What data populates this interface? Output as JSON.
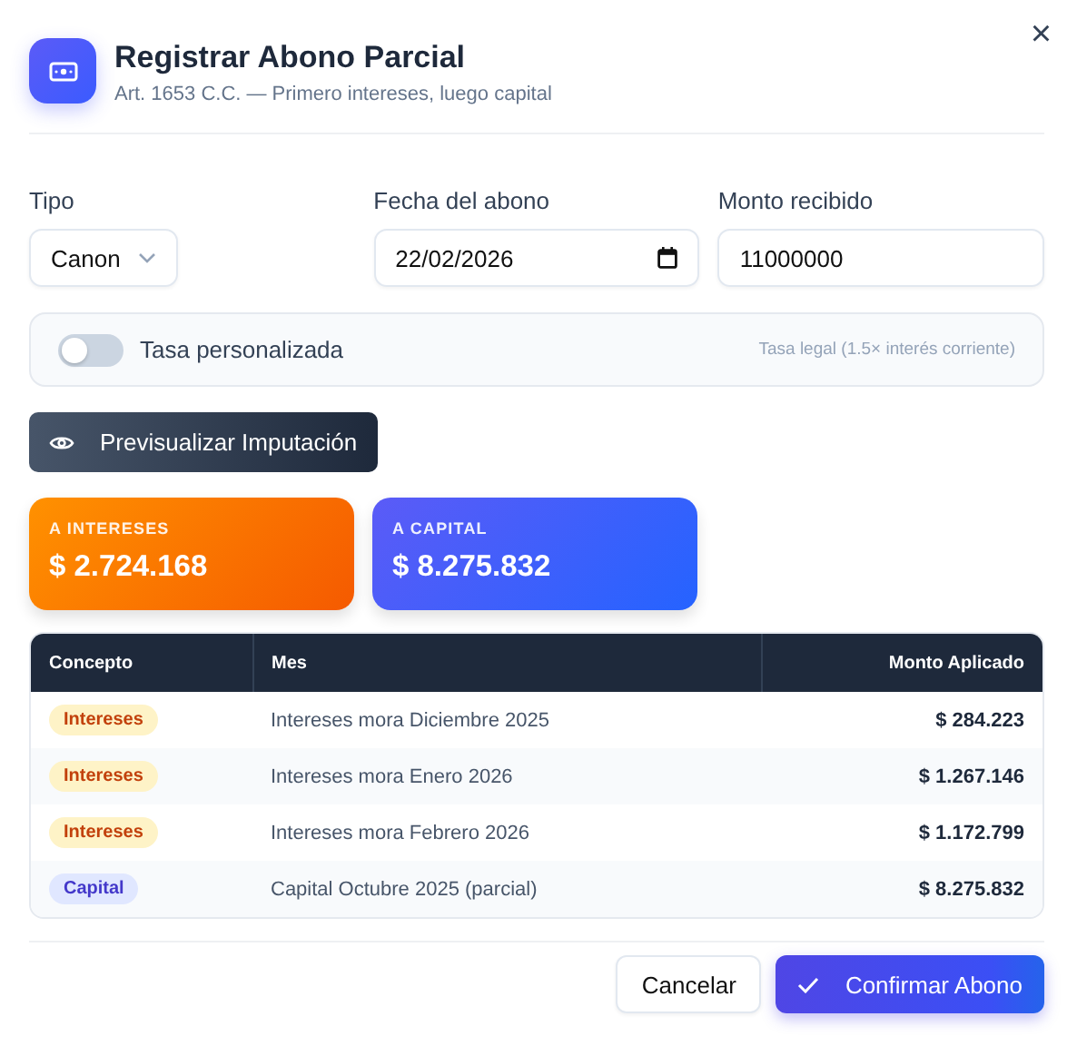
{
  "dialog": {
    "title": "Registrar Abono Parcial",
    "subtitle": "Art. 1653 C.C. — Primero intereses, luego capital",
    "close": "×"
  },
  "fields": {
    "tipo": {
      "label": "Tipo",
      "value": "Canon"
    },
    "fecha": {
      "label": "Fecha del abono",
      "value": "22/02/2026"
    },
    "monto": {
      "label": "Monto recibido",
      "value": "11000000"
    }
  },
  "custom_rate": {
    "label": "Tasa personalizada",
    "on": false,
    "hint": "Tasa legal (1.5× interés corriente)"
  },
  "preview_button": "Previsualizar Imputación",
  "totals": [
    {
      "kind": "interest",
      "label": "A INTERESES",
      "value": "$ 2.724.168"
    },
    {
      "kind": "capital",
      "label": "A CAPITAL",
      "value": "$ 8.275.832"
    }
  ],
  "table": {
    "columns": [
      "Concepto",
      "Mes",
      "Monto Aplicado"
    ],
    "rows": [
      {
        "kind": "interest",
        "concept": "Intereses",
        "month": "Intereses mora Diciembre 2025",
        "amount": "$ 284.223"
      },
      {
        "kind": "interest",
        "concept": "Intereses",
        "month": "Intereses mora Enero 2026",
        "amount": "$ 1.267.146"
      },
      {
        "kind": "interest",
        "concept": "Intereses",
        "month": "Intereses mora Febrero 2026",
        "amount": "$ 1.172.799"
      },
      {
        "kind": "capital",
        "concept": "Capital",
        "month": "Capital Octubre 2025 (parcial)",
        "amount": "$ 8.275.832"
      }
    ]
  },
  "buttons": {
    "cancel": "Cancelar",
    "confirm": "Confirmar Abono"
  }
}
